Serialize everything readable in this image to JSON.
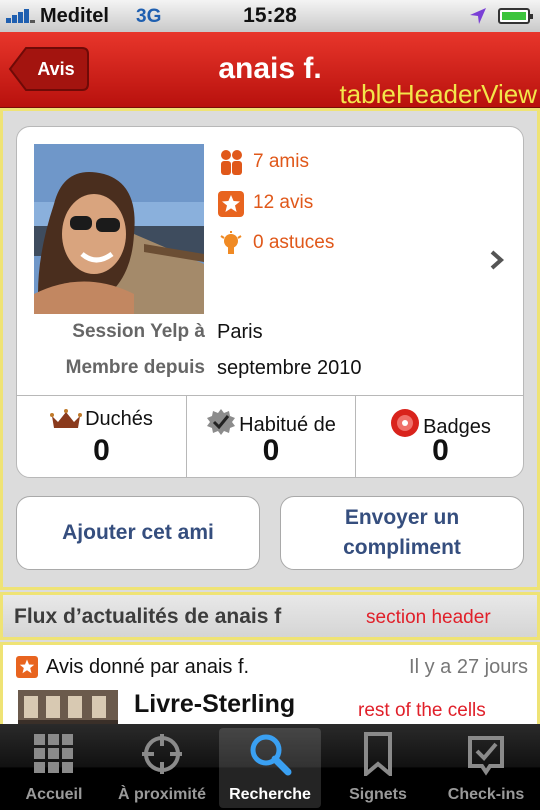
{
  "status_bar": {
    "carrier": "Meditel",
    "network": "3G",
    "time": "15:28"
  },
  "nav": {
    "back_label": "Avis",
    "title": "anais f.",
    "annotation": "tableHeaderView"
  },
  "profile": {
    "stats": [
      {
        "icon": "friends-icon",
        "label": "7 amis"
      },
      {
        "icon": "review-star-icon",
        "label": "12 avis"
      },
      {
        "icon": "tip-lightbulb-icon",
        "label": "0 astuces"
      }
    ],
    "info": [
      {
        "label": "Session Yelp à",
        "value": "Paris"
      },
      {
        "label": "Membre depuis",
        "value": "septembre 2010"
      }
    ],
    "counts": [
      {
        "icon": "crown-icon",
        "label": "Duchés",
        "value": "0"
      },
      {
        "icon": "checkmark-badge-icon",
        "label": "Habitué de",
        "value": "0"
      },
      {
        "icon": "badges-icon",
        "label": "Badges",
        "value": "0"
      }
    ]
  },
  "actions": {
    "add_friend": "Ajouter cet ami",
    "compliment_line1": "Envoyer un",
    "compliment_line2": "compliment"
  },
  "section_header": {
    "title": "Flux d’actualités de anais f",
    "annotation": "section header"
  },
  "feed_cell": {
    "title": "Avis donné par anais f.",
    "date": "Il y a 27 jours",
    "business": "Livre-Sterling",
    "annotation": "rest of the cells"
  },
  "tabs": [
    {
      "label": "Accueil",
      "icon": "grid-icon",
      "selected": false
    },
    {
      "label": "À proximité",
      "icon": "crosshair-icon",
      "selected": false
    },
    {
      "label": "Recherche",
      "icon": "search-icon",
      "selected": true
    },
    {
      "label": "Signets",
      "icon": "bookmark-icon",
      "selected": false
    },
    {
      "label": "Check-ins",
      "icon": "checkin-icon",
      "selected": false
    }
  ],
  "colors": {
    "nav_red": "#d0241b",
    "stat_orange": "#e0581a",
    "button_blue": "#354e7e",
    "annotation_yellow": "#f3e64a",
    "annotation_red": "#e0202a"
  }
}
